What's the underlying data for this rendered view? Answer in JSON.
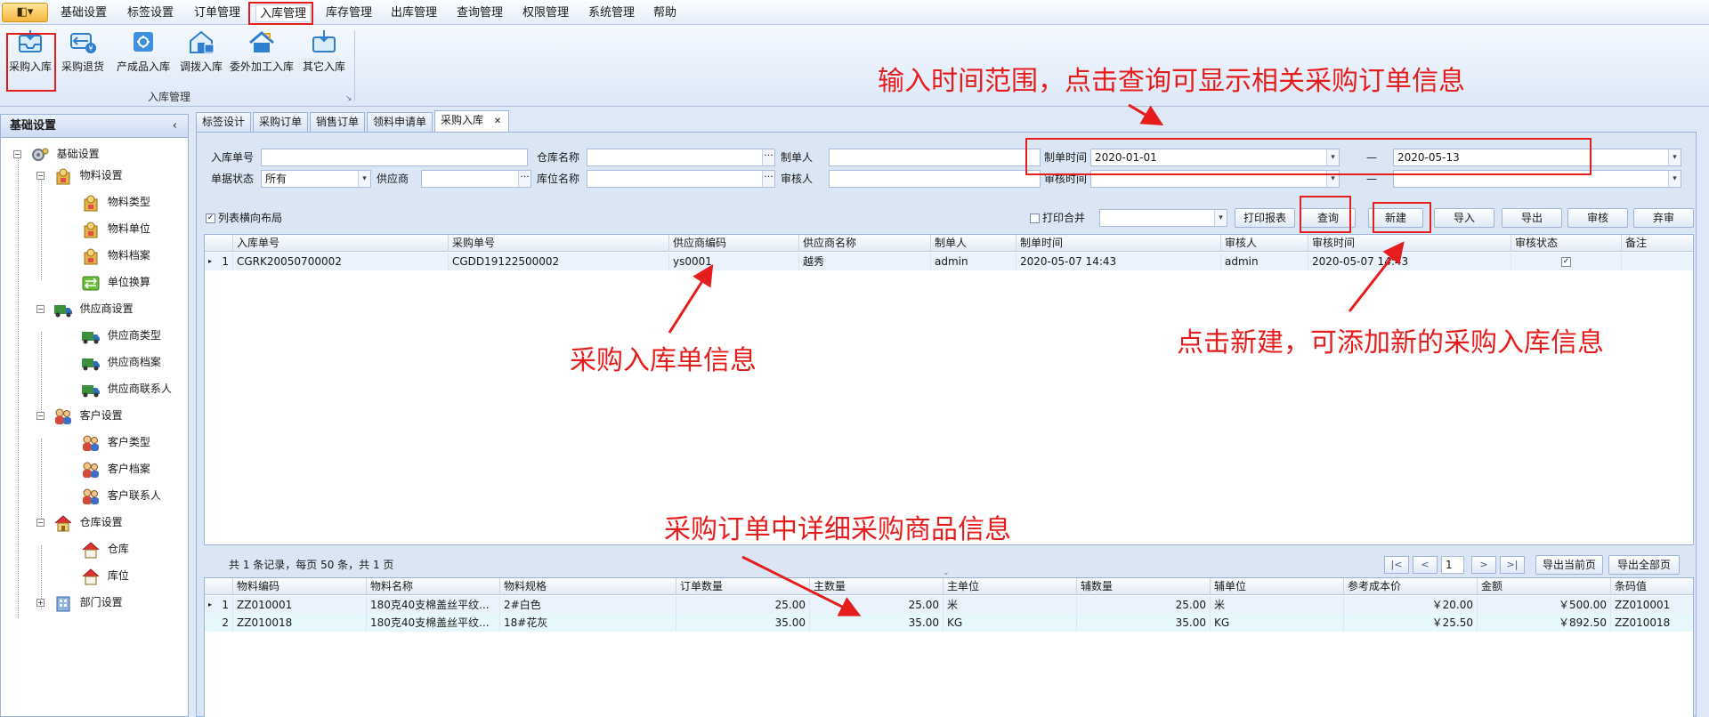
{
  "menu": {
    "app_glyph": "◧▾",
    "items": [
      "基础设置",
      "标签设置",
      "订单管理",
      "入库管理",
      "库存管理",
      "出库管理",
      "查询管理",
      "权限管理",
      "系统管理",
      "帮助"
    ]
  },
  "ribbon": {
    "buttons": [
      {
        "label": "采购入库",
        "icon": "inbox-icon"
      },
      {
        "label": "采购退货",
        "icon": "return-icon"
      },
      {
        "label": "产成品入库",
        "icon": "product-in-icon"
      },
      {
        "label": "调拨入库",
        "icon": "transfer-icon"
      },
      {
        "label": "委外加工入库",
        "icon": "outsource-icon"
      },
      {
        "label": "其它入库",
        "icon": "other-in-icon"
      }
    ],
    "group_label": "入库管理",
    "expander_glyph": "↘"
  },
  "left_panel": {
    "title": "基础设置",
    "collapse_glyph": "‹",
    "tree": [
      {
        "label": "基础设置",
        "level": 0
      },
      {
        "label": "物料设置",
        "level": 1
      },
      {
        "label": "物料类型",
        "level": 2
      },
      {
        "label": "物料单位",
        "level": 2
      },
      {
        "label": "物料档案",
        "level": 2
      },
      {
        "label": "单位换算",
        "level": 2
      },
      {
        "label": "供应商设置",
        "level": 1
      },
      {
        "label": "供应商类型",
        "level": 2
      },
      {
        "label": "供应商档案",
        "level": 2
      },
      {
        "label": "供应商联系人",
        "level": 2
      },
      {
        "label": "客户设置",
        "level": 1
      },
      {
        "label": "客户类型",
        "level": 2
      },
      {
        "label": "客户档案",
        "level": 2
      },
      {
        "label": "客户联系人",
        "level": 2
      },
      {
        "label": "仓库设置",
        "level": 1
      },
      {
        "label": "仓库",
        "level": 2
      },
      {
        "label": "库位",
        "level": 2
      },
      {
        "label": "部门设置",
        "level": 1
      }
    ]
  },
  "tabs": {
    "items": [
      "标签设计",
      "采购订单",
      "销售订单",
      "领料申请单",
      "采购入库"
    ],
    "active": "采购入库",
    "close_glyph": "✕"
  },
  "filters": {
    "inbound_no_label": "入库单号",
    "inbound_no_value": "",
    "warehouse_label": "仓库名称",
    "warehouse_value": "",
    "creator_label": "制单人",
    "creator_value": "",
    "create_time_label": "制单时间",
    "create_time_from": "2020-01-01",
    "create_time_to": "2020-05-13",
    "range_sep": "—",
    "status_label": "单据状态",
    "status_value": "所有",
    "supplier_label": "供应商",
    "supplier_value": "",
    "location_label": "库位名称",
    "location_value": "",
    "auditor_label": "审核人",
    "auditor_value": "",
    "audit_time_label": "审核时间",
    "audit_time_from": "",
    "audit_time_to": "",
    "ellipsis_glyph": "···",
    "dropdown_glyph": "▾"
  },
  "toolbar": {
    "layout_checkbox_label": "列表横向布局",
    "layout_checked": "✓",
    "print_merge_label": "打印合并",
    "print_template_value": "",
    "print_report": "打印报表",
    "query": "查询",
    "new": "新建",
    "import": "导入",
    "export": "导出",
    "audit": "审核",
    "unaudit": "弃审"
  },
  "master_grid": {
    "columns": [
      "入库单号",
      "采购单号",
      "供应商编码",
      "供应商名称",
      "制单人",
      "制单时间",
      "审核人",
      "审核时间",
      "审核状态",
      "备注"
    ],
    "rows": [
      {
        "no": "1",
        "indicator": "▸",
        "cells": [
          "CGRK20050700002",
          "CGDD19122500002",
          "ys0001",
          "越秀",
          "admin",
          "2020-05-07 14:43",
          "admin",
          "2020-05-07 14:43",
          "✓",
          ""
        ]
      }
    ]
  },
  "pager": {
    "summary": "共 1 条记录，每页 50 条，共 1 页",
    "first": "|<",
    "prev": "<",
    "page": "1",
    "next": ">",
    "last": ">|",
    "export_current": "导出当前页",
    "export_all": "导出全部页",
    "splitter_glyph": "⌄"
  },
  "detail_grid": {
    "columns": [
      "物料编码",
      "物料名称",
      "物料规格",
      "订单数量",
      "主数量",
      "主单位",
      "辅数量",
      "辅单位",
      "参考成本价",
      "金额",
      "条码值"
    ],
    "rows": [
      {
        "no": "1",
        "indicator": "▸",
        "cells": [
          "ZZ010001",
          "180克40支棉盖丝平纹...",
          "2#白色",
          "25.00",
          "25.00",
          "米",
          "25.00",
          "米",
          "￥20.00",
          "￥500.00",
          "ZZ010001"
        ]
      },
      {
        "no": "2",
        "indicator": "",
        "cells": [
          "ZZ010018",
          "180克40支棉盖丝平纹...",
          "18#花灰",
          "35.00",
          "35.00",
          "KG",
          "35.00",
          "KG",
          "￥25.50",
          "￥892.50",
          "ZZ010018"
        ]
      }
    ]
  },
  "annotations": {
    "time_range": "输入时间范围，点击查询可显示相关采购订单信息",
    "inbound_info": "采购入库单信息",
    "new_hint": "点击新建，可添加新的采购入库信息",
    "detail_hint": "采购订单中详细采购商品信息",
    "color": "#e51d1d"
  },
  "colors": {
    "accent_blue": "#99b3d8",
    "selected_row": "#eaf2fc",
    "alt_row": "#e6f8fb"
  }
}
